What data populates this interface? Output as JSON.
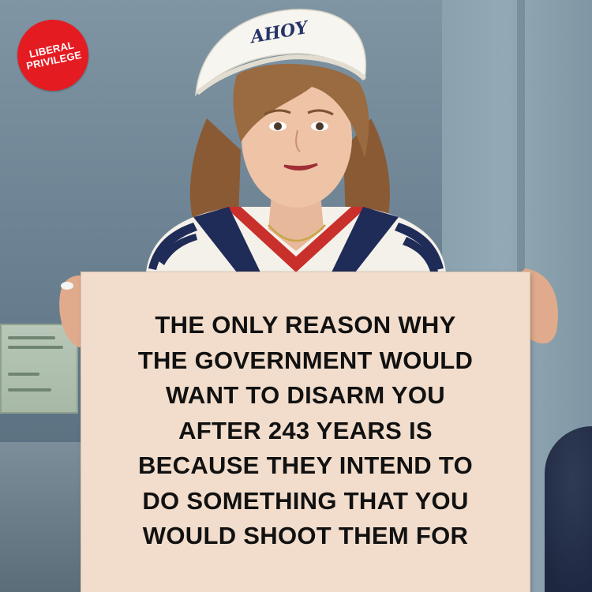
{
  "logo": {
    "lines": [
      "LIBERAL",
      "PRIVILEGE"
    ],
    "color": "#e51b22"
  },
  "hat": {
    "text": "AHOY"
  },
  "sign": {
    "lines": [
      "THE ONLY REASON WHY",
      "THE GOVERNMENT WOULD",
      "WANT TO DISARM YOU",
      "AFTER 243 YEARS IS",
      "BECAUSE THEY INTEND TO",
      "DO SOMETHING THAT YOU",
      "WOULD SHOOT THEM FOR"
    ],
    "background": "#f2ddcc"
  }
}
